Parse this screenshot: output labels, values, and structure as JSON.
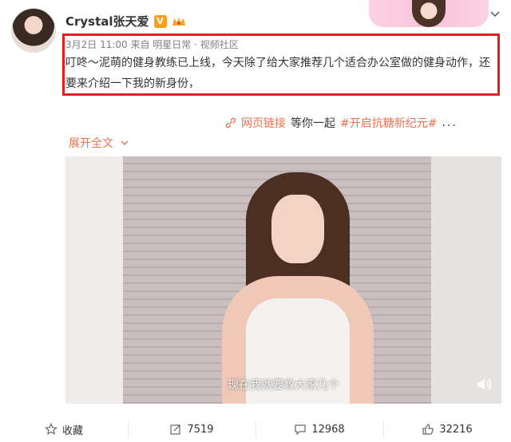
{
  "post": {
    "username": "Crystal张天爱",
    "verified_badge": "V",
    "meta": "3月2日 11:00 来自 明星日常 · 视频社区",
    "content": "叮咚～泥萌的健身教练已上线，今天除了给大家推荐几个适合办公室做的健身动作，还要来介绍一下我的新身份，",
    "web_link_label": "网页链接",
    "together_text": "等你一起",
    "hashtag": "#开启抗糖新纪元#",
    "more": "...",
    "expand_label": "展开全文"
  },
  "video": {
    "subtitle": "现在我就要教大家几个"
  },
  "actions": {
    "favorite": "收藏",
    "reposts": "7519",
    "comments": "12968",
    "likes": "32216"
  },
  "colors": {
    "link": "#eb7350",
    "highlight_border": "#e02020",
    "badge": "#f7a11a"
  },
  "icons": [
    "crown-icon",
    "chevron-down-icon",
    "link-icon",
    "volume-icon",
    "star-icon",
    "repost-icon",
    "comment-icon",
    "thumbs-up-icon"
  ]
}
